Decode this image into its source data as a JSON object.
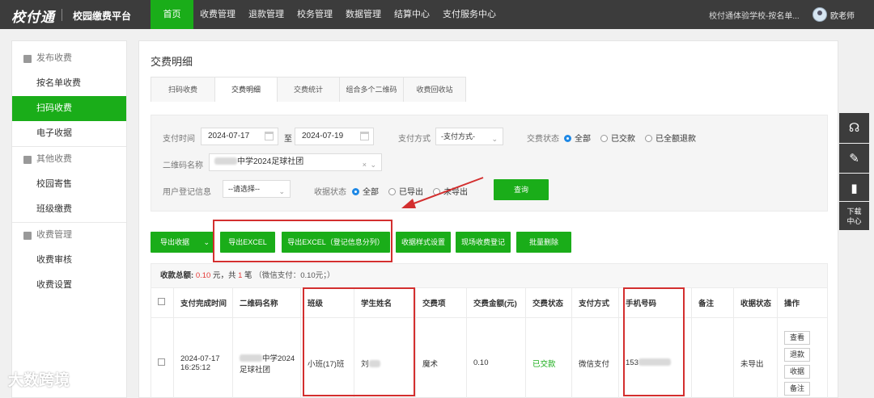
{
  "header": {
    "logo": "校付通",
    "platform": "校园缴费平台",
    "nav": [
      "首页",
      "收费管理",
      "退款管理",
      "校务管理",
      "数据管理",
      "结算中心",
      "支付服务中心"
    ],
    "school": "校付通体验学校-按名单...",
    "user": "欧老师"
  },
  "sidebar": {
    "groups": [
      {
        "label": "发布收费",
        "items": [
          "按名单收费",
          "扫码收费",
          "电子收据"
        ]
      },
      {
        "label": "其他收费",
        "items": [
          "校园寄售",
          "班级缴费"
        ]
      },
      {
        "label": "收费管理",
        "items": [
          "收费审核",
          "收费设置"
        ]
      }
    ],
    "active": "扫码收费"
  },
  "main": {
    "title": "交费明细",
    "tabs": [
      "扫码收费",
      "交费明细",
      "交费统计",
      "组合多个二维码",
      "收费回收站"
    ],
    "active_tab": "交费明细"
  },
  "filter": {
    "pay_time_label": "支付时间",
    "date_from": "2024-07-17",
    "to": "至",
    "date_to": "2024-07-19",
    "pay_method_label": "支付方式",
    "pay_method_value": "-支付方式-",
    "status_label": "交费状态",
    "status_options": [
      "全部",
      "已交款",
      "已全额退款"
    ],
    "qr_label": "二维码名称",
    "qr_value": "中学2024足球社团",
    "user_info_label": "用户登记信息",
    "user_info_value": "--请选择--",
    "receipt_label": "收据状态",
    "receipt_options": [
      "全部",
      "已导出",
      "未导出"
    ],
    "query": "查询"
  },
  "actions": {
    "export_receipt": "导出收据",
    "export_excel": "导出EXCEL",
    "export_excel_split": "导出EXCEL（登记信息分列）",
    "receipt_style": "收据样式设置",
    "onsite": "现场收费登记",
    "batch_delete": "批量删除"
  },
  "summary": {
    "label": "收款总额:",
    "amount": "0.10",
    "yuan": "元，共",
    "count": "1",
    "unit": "笔",
    "wechat": "（微信支付：0.10元；）"
  },
  "table": {
    "columns": [
      "支付完成时间",
      "二维码名称",
      "班级",
      "学生姓名",
      "交费项",
      "交费金额(元)",
      "交费状态",
      "支付方式",
      "手机号码",
      "备注",
      "收据状态",
      "操作"
    ],
    "row": {
      "time": "2024-07-17 16:25:12",
      "qr_name": "中学2024足球社团",
      "class": "小班(17)班",
      "student": "刘",
      "item": "魔术",
      "amount": "0.10",
      "status": "已交款",
      "method": "微信支付",
      "phone": "153",
      "remark": "",
      "receipt": "未导出",
      "ops": [
        "查看",
        "退款",
        "收据",
        "备注"
      ]
    }
  },
  "float_bar": {
    "download": "下载中心"
  },
  "watermark": "大数跨境",
  "colors": {
    "green": "#1aad19",
    "dark": "#3c3c3c",
    "highlight": "#d32f2f"
  }
}
